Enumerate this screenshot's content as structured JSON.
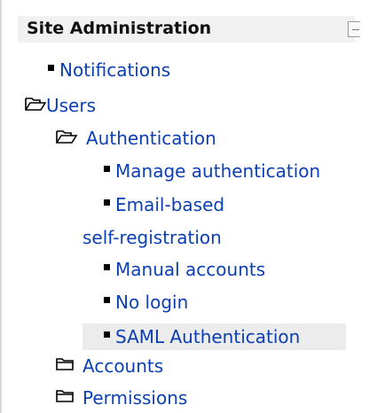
{
  "block": {
    "title": "Site Administration",
    "collapse_icon": "minus-box-icon"
  },
  "tree": {
    "notifications": "Notifications",
    "users": "Users",
    "authentication": "Authentication",
    "manage_authentication": "Manage authentication",
    "email_based_line1": "Email-based",
    "email_based_line2": "self-registration",
    "manual_accounts": "Manual accounts",
    "no_login": "No login",
    "saml_authentication": "SAML Authentication",
    "accounts": "Accounts",
    "permissions": "Permissions"
  },
  "colors": {
    "link": "#0b3fb3",
    "header_bg": "#f1f1f1",
    "selected_bg": "#ececec"
  },
  "icons": {
    "expanded_folder": "open-folder-icon",
    "collapsed_folder": "closed-folder-icon",
    "leaf": "square-bullet-icon"
  }
}
